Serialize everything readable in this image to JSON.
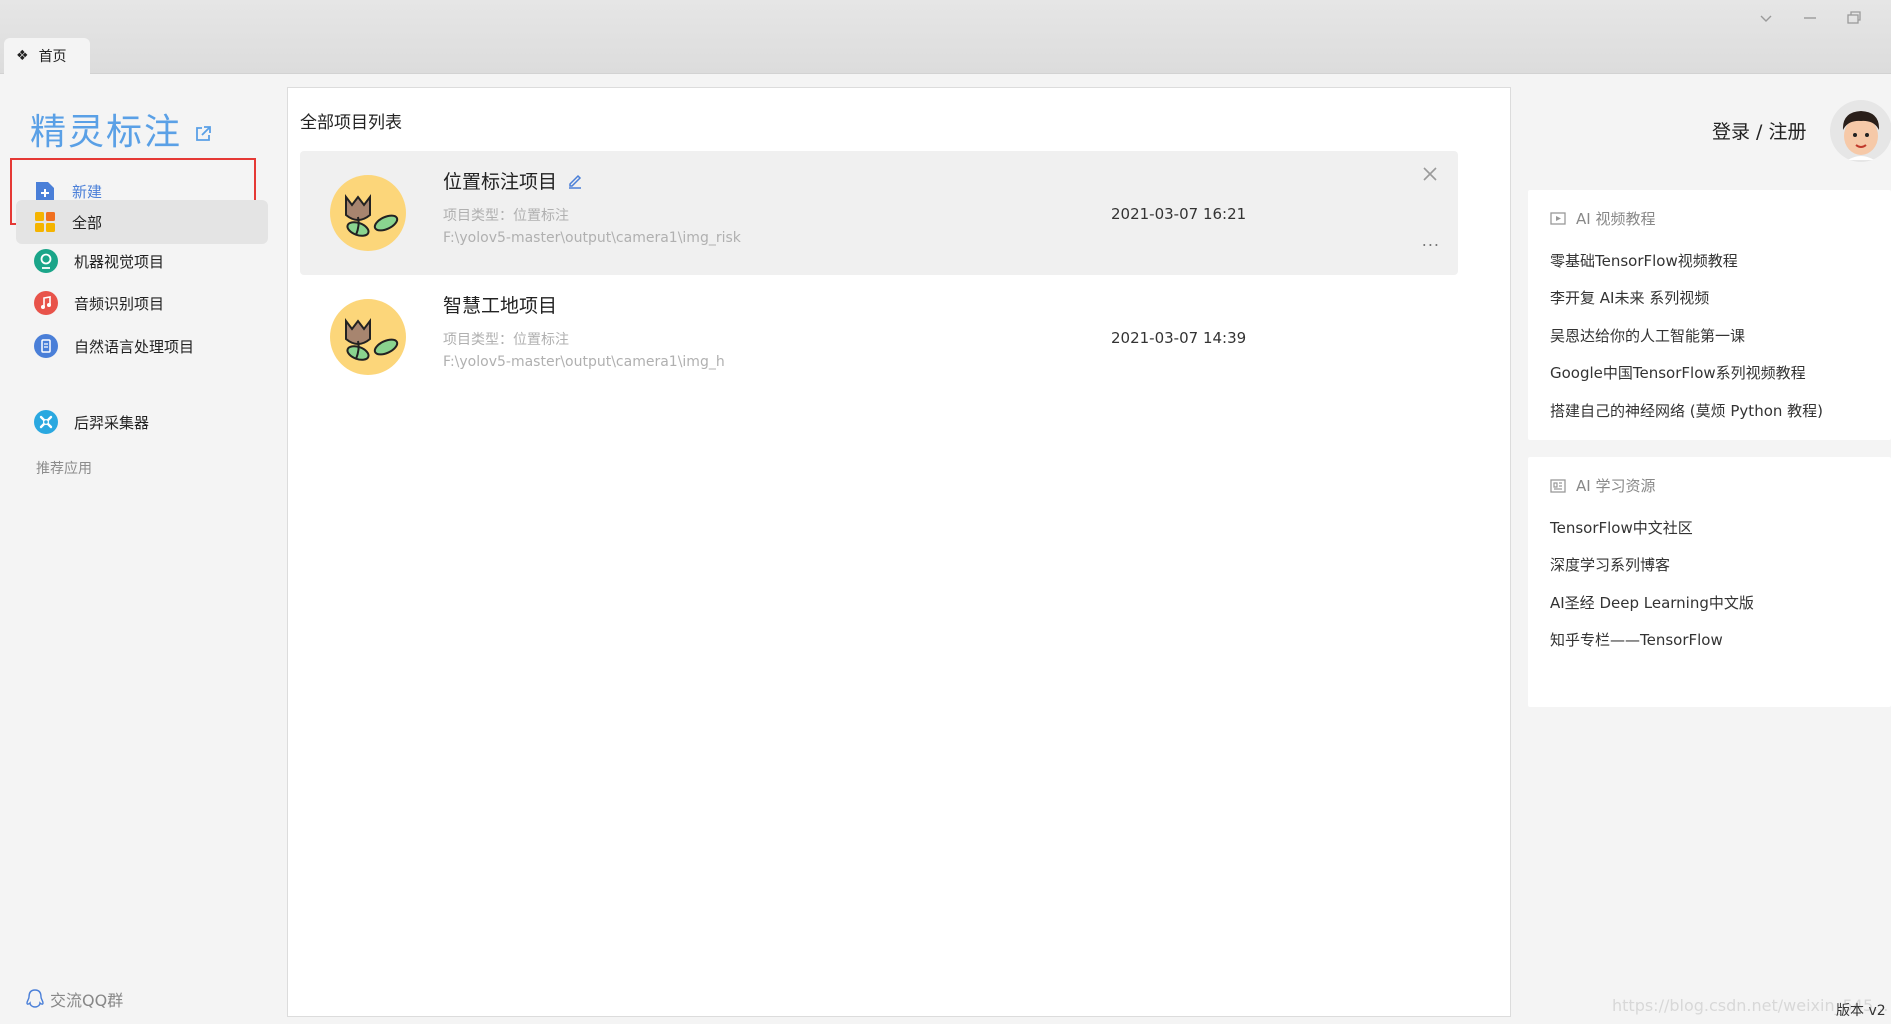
{
  "tab": {
    "label": "首页",
    "icon": "apps-icon"
  },
  "window_controls": [
    "chevron-down-icon",
    "minimize-icon",
    "restore-icon"
  ],
  "sidebar": {
    "brand": "精灵标注",
    "new_label": "新建",
    "nav": [
      {
        "label": "全部",
        "icon": "grid-icon",
        "active": true
      },
      {
        "label": "机器视觉项目",
        "icon": "vision-icon"
      },
      {
        "label": "音频识别项目",
        "icon": "audio-icon"
      },
      {
        "label": "自然语言处理项目",
        "icon": "nlp-icon"
      }
    ],
    "recommend_label": "推荐应用",
    "apps": [
      {
        "label": "后羿采集器",
        "icon": "collector-icon"
      }
    ],
    "qq_label": "交流QQ群"
  },
  "main": {
    "title": "全部项目列表",
    "projects": [
      {
        "name": "位置标注项目",
        "type": "项目类型：位置标注",
        "path": "F:\\yolov5-master\\output\\camera1\\img_risk",
        "time": "2021-03-07 16:21"
      },
      {
        "name": "智慧工地项目",
        "type": "项目类型：位置标注",
        "path": "F:\\yolov5-master\\output\\camera1\\img_h",
        "time": "2021-03-07 14:39"
      }
    ],
    "more_label": "..."
  },
  "right": {
    "login_label": "登录 / 注册",
    "video_card": {
      "title": "AI 视频教程",
      "links": [
        "零基础TensorFlow视频教程",
        "李开复 AI未来 系列视频",
        "吴恩达给你的人工智能第一课",
        "Google中国TensorFlow系列视频教程",
        "搭建自己的神经网络 (莫烦 Python 教程)"
      ]
    },
    "resource_card": {
      "title": "AI 学习资源",
      "links": [
        "TensorFlow中文社区",
        "深度学习系列博客",
        "AI圣经 Deep Learning中文版",
        "知乎专栏——TensorFlow"
      ]
    }
  },
  "footer": {
    "version": "版本 v2",
    "watermark": "https://blog.csdn.net/weixin_545..."
  },
  "colors": {
    "brand": "#5aa0e6",
    "highlight_border": "#e53935",
    "link_blue": "#4a7fd8"
  }
}
